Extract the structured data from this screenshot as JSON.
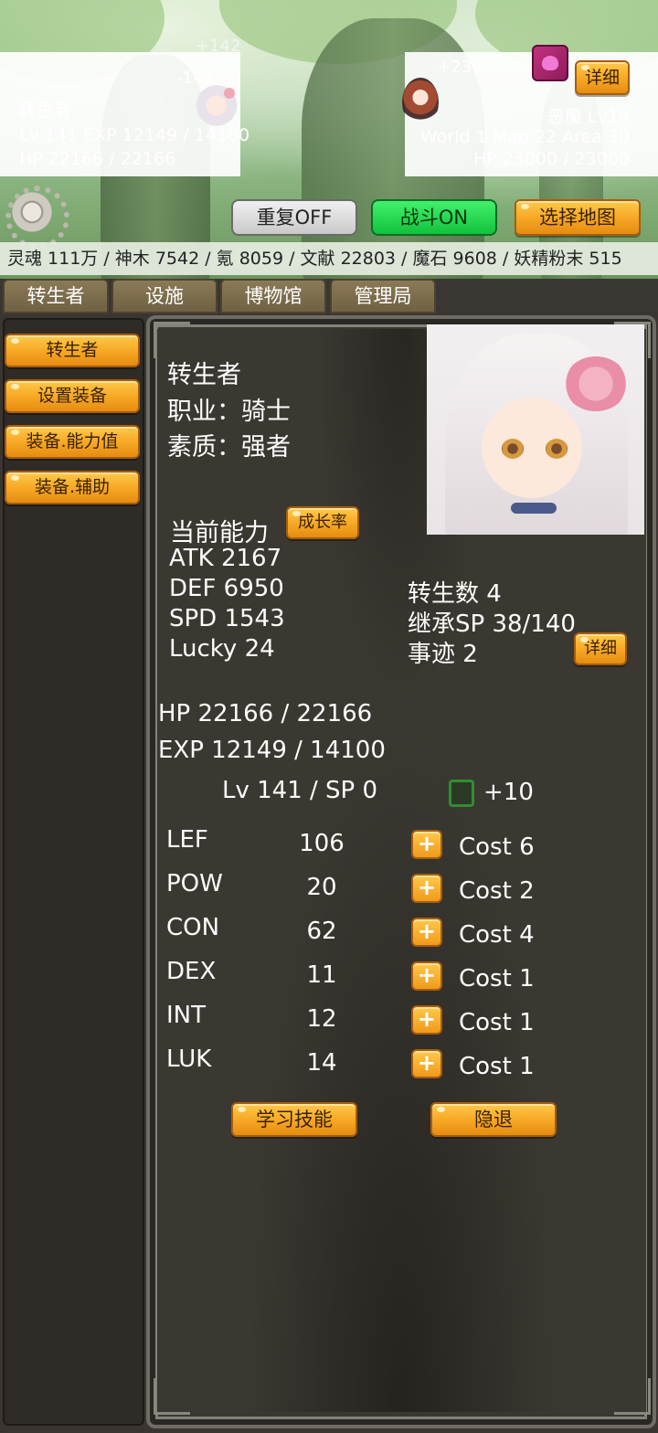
{
  "battle": {
    "player": {
      "name": "转生者",
      "lv_exp": "Lv 141 EXP 12149 / 14100",
      "hp": "HP 22166 / 22166",
      "damage_taken": "-142",
      "heal_faded": "+142"
    },
    "enemy": {
      "heal": "+230",
      "name": "恶魔 Lv19",
      "location": "World 1 Map 22 Area 30",
      "hp": "HP 23000 / 23000",
      "detail_label": "详细"
    }
  },
  "controls": {
    "repeat_label": "重复OFF",
    "battle_label": "战斗ON",
    "map_label": "选择地图"
  },
  "resources": "灵魂 111万 / 神木 7542 / 氪 8059 / 文献 22803 / 魔石 9608 / 妖精粉末 515",
  "tabs": [
    "转生者",
    "设施",
    "博物馆",
    "管理局"
  ],
  "sidebar": {
    "items": [
      "转生者",
      "设置装备",
      "装备.能力值",
      "装备.辅助"
    ]
  },
  "character": {
    "title": "转生者",
    "job": "职业：骑士",
    "trait": "素质：强者",
    "ability_header": "当前能力",
    "growth_label": "成长率",
    "atk": "ATK 2167",
    "def": "DEF 6950",
    "spd": "SPD 1543",
    "lucky": "Lucky 24",
    "rebirth_count": "转生数 4",
    "inherit_sp": "继承SP 38/140",
    "deeds": "事迹 2",
    "detail_label": "详细",
    "hp": "HP 22166 / 22166",
    "exp": "EXP 12149 / 14100",
    "lv_sp": "Lv 141 / SP 0",
    "plus_ten": "+10",
    "plus_ten_checked": false
  },
  "stats": [
    {
      "name": "LEF",
      "value": "106",
      "cost": "Cost 6"
    },
    {
      "name": "POW",
      "value": "20",
      "cost": "Cost 2"
    },
    {
      "name": "CON",
      "value": "62",
      "cost": "Cost 4"
    },
    {
      "name": "DEX",
      "value": "11",
      "cost": "Cost 1"
    },
    {
      "name": "INT",
      "value": "12",
      "cost": "Cost 1"
    },
    {
      "name": "LUK",
      "value": "14",
      "cost": "Cost 1"
    }
  ],
  "actions": {
    "learn_skill": "学习技能",
    "retire": "隐退"
  },
  "icons": {
    "settings": "gear-icon",
    "enemy_type": "demon-icon",
    "plus": "plus-icon",
    "plus_glyph": "+"
  },
  "colors": {
    "accent_orange": "#f6a623",
    "battle_on_green": "#12c23c",
    "damage_red": "#e47c6c",
    "heal_green": "#2f9a2a"
  }
}
